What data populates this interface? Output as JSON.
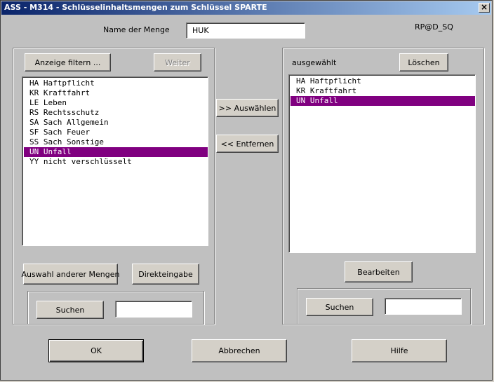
{
  "window": {
    "title": "ASS - M314 - Schlüsselinhaltsmengen zum Schlüssel SPARTE",
    "close_symbol": "×"
  },
  "header": {
    "menge_label": "Name der Menge",
    "menge_value": "HUK",
    "code": "RP@D_SQ"
  },
  "left": {
    "filter_button": "Anzeige filtern ...",
    "weiter_button": "Weiter",
    "items": [
      {
        "label": "HA Haftpflicht",
        "selected": false
      },
      {
        "label": "KR Kraftfahrt",
        "selected": false
      },
      {
        "label": "LE Leben",
        "selected": false
      },
      {
        "label": "RS Rechtsschutz",
        "selected": false
      },
      {
        "label": "SA Sach Allgemein",
        "selected": false
      },
      {
        "label": "SF Sach Feuer",
        "selected": false
      },
      {
        "label": "SS Sach Sonstige",
        "selected": false
      },
      {
        "label": "UN Unfall",
        "selected": true
      },
      {
        "label": "YY nicht verschlüsselt",
        "selected": false
      }
    ],
    "auswahl_button": "Auswahl anderer Mengen",
    "direkt_button": "Direkteingabe",
    "suchen_button": "Suchen",
    "suchen_value": ""
  },
  "middle": {
    "auswaehlen_button": ">> Auswählen",
    "entfernen_button": "<< Entfernen"
  },
  "right": {
    "ausgewaehlt_label": "ausgewählt",
    "loeschen_button": "Löschen",
    "items": [
      {
        "label": "HA Haftpflicht",
        "selected": false
      },
      {
        "label": "KR Kraftfahrt",
        "selected": false
      },
      {
        "label": "UN Unfall",
        "selected": true
      }
    ],
    "bearbeiten_button": "Bearbeiten",
    "suchen_button": "Suchen",
    "suchen_value": ""
  },
  "footer": {
    "ok_button": "OK",
    "abbrechen_button": "Abbrechen",
    "hilfe_button": "Hilfe"
  },
  "colors": {
    "selection": "#800080",
    "title_start": "#0a246a",
    "title_end": "#a6caf0",
    "face": "#c0c0c0"
  }
}
